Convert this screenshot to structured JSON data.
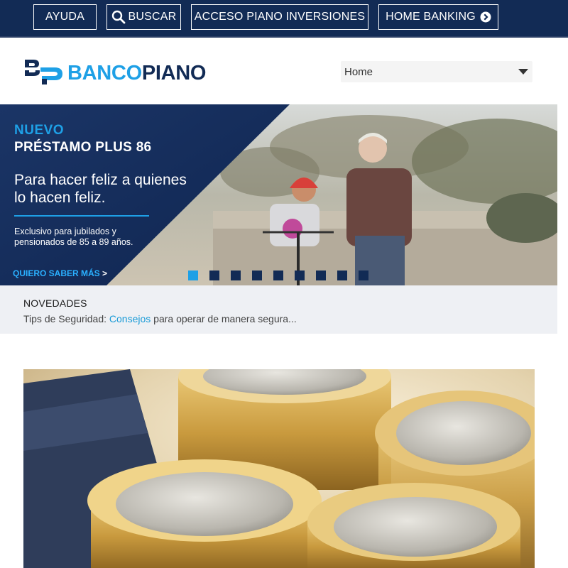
{
  "topbar": {
    "help_label": "AYUDA",
    "search_label": "BUSCAR",
    "investments_label": "ACCESO PIANO INVERSIONES",
    "homebanking_label": "HOME BANKING"
  },
  "header": {
    "logo_part1": "BANCO",
    "logo_part2": "PIANO",
    "nav_select_value": "Home"
  },
  "hero": {
    "kicker": "NUEVO",
    "title": "PRÉSTAMO PLUS 86",
    "lead": "Para hacer feliz a quienes lo hacen feliz.",
    "detail": "Exclusivo para jubilados y pensionados de  85 a 89 años.",
    "cta": "QUIERO SABER MÁS",
    "cta_arrow": ">",
    "slide_count": 9,
    "active_slide": 1
  },
  "news": {
    "label": "NOVEDADES",
    "prefix": "Tips de Seguridad: ",
    "link": "Consejos",
    "suffix": " para operar de manera segura..."
  },
  "colors": {
    "navy": "#122b55",
    "accent": "#1ea0e6",
    "news_bg": "#eef0f4"
  },
  "icons": [
    "search-icon",
    "arrow-circle-right-icon",
    "chevron-down-icon",
    "bp-logo-icon"
  ]
}
